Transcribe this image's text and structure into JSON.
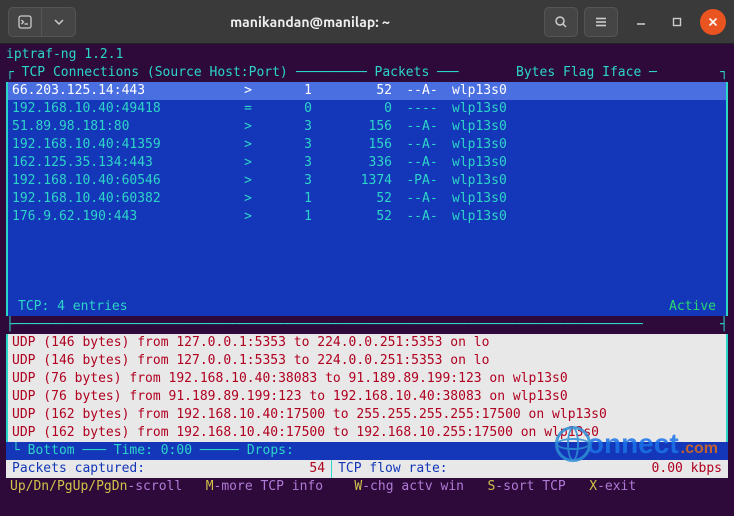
{
  "window": {
    "title": "manikandan@manilap: ~"
  },
  "app": {
    "name_version": "iptraf-ng 1.2.1"
  },
  "headers": {
    "tcp_header_label": "TCP Connections (Source Host:Port)",
    "packets": "Packets",
    "bytes": "Bytes",
    "flag": "Flag",
    "iface": "Iface"
  },
  "tcp": {
    "rows": [
      {
        "host": "66.203.125.14:443",
        "dir": ">",
        "packets": "1",
        "bytes": "52",
        "flag": "--A-",
        "iface": "wlp13s0",
        "selected": true
      },
      {
        "host": "192.168.10.40:49418",
        "dir": "=",
        "packets": "0",
        "bytes": "0",
        "flag": "----",
        "iface": "wlp13s0"
      },
      {
        "host": "51.89.98.181:80",
        "dir": ">",
        "packets": "3",
        "bytes": "156",
        "flag": "--A-",
        "iface": "wlp13s0"
      },
      {
        "host": "192.168.10.40:41359",
        "dir": ">",
        "packets": "3",
        "bytes": "156",
        "flag": "--A-",
        "iface": "wlp13s0"
      },
      {
        "host": "162.125.35.134:443",
        "dir": ">",
        "packets": "3",
        "bytes": "336",
        "flag": "--A-",
        "iface": "wlp13s0"
      },
      {
        "host": "192.168.10.40:60546",
        "dir": ">",
        "packets": "3",
        "bytes": "1374",
        "flag": "-PA-",
        "iface": "wlp13s0"
      },
      {
        "host": "192.168.10.40:60382",
        "dir": ">",
        "packets": "1",
        "bytes": "52",
        "flag": "--A-",
        "iface": "wlp13s0"
      },
      {
        "host": "176.9.62.190:443",
        "dir": ">",
        "packets": "1",
        "bytes": "52",
        "flag": "--A-",
        "iface": "wlp13s0"
      }
    ],
    "summary_left": "TCP:      4 entries",
    "summary_right": "Active"
  },
  "udp": {
    "lines": [
      "UDP (146 bytes) from 127.0.0.1:5353 to 224.0.0.251:5353 on lo",
      "UDP (146 bytes) from 127.0.0.1:5353 to 224.0.0.251:5353 on lo",
      "UDP (76 bytes) from 192.168.10.40:38083 to 91.189.89.199:123 on wlp13s0",
      "UDP (76 bytes) from 91.189.89.199:123 to 192.168.10.40:38083 on wlp13s0",
      "UDP (162 bytes) from 192.168.10.40:17500 to 255.255.255.255:17500 on wlp13s0",
      "UDP (162 bytes) from 192.168.10.40:17500 to 192.168.10.255:17500 on wlp13s0"
    ]
  },
  "status": {
    "bottom_label": "Bottom",
    "time_label": "Time:",
    "time_value": "0:00",
    "drops_label": "Drops:",
    "captured_label": "Packets captured:",
    "captured_value": "54",
    "flow_label": "TCP flow rate:",
    "flow_value": "0.00 kbps"
  },
  "help": {
    "k1": "Up/Dn/PgUp/PgDn",
    "v1": "-scroll",
    "k2": "M",
    "v2": "-more TCP info",
    "k3": "W",
    "v3": "-chg actv win",
    "k4": "S",
    "v4": "-sort TCP",
    "k5": "X",
    "v5": "-exit"
  },
  "watermark": {
    "text1": "onnect",
    "text2": ".com"
  }
}
